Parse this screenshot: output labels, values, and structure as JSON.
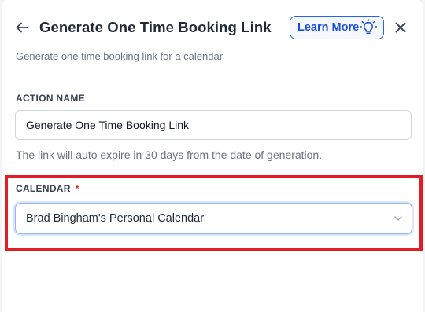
{
  "header": {
    "title": "Generate One Time Booking Link",
    "learn_more_label": "Learn More",
    "subtitle": "Generate one time booking link for a calendar"
  },
  "action_name": {
    "label": "ACTION NAME",
    "value": "Generate One Time Booking Link",
    "help_text": "The link will auto expire in 30 days from the date of generation."
  },
  "calendar": {
    "label": "CALENDAR",
    "required_marker": "*",
    "selected_value": "Brad Bingham's Personal Calendar"
  },
  "colors": {
    "accent": "#2563eb",
    "highlight": "#e11d25",
    "required": "#dc2626"
  },
  "icons": [
    "back-arrow-icon",
    "lightbulb-icon",
    "close-icon",
    "chevron-down-icon"
  ]
}
